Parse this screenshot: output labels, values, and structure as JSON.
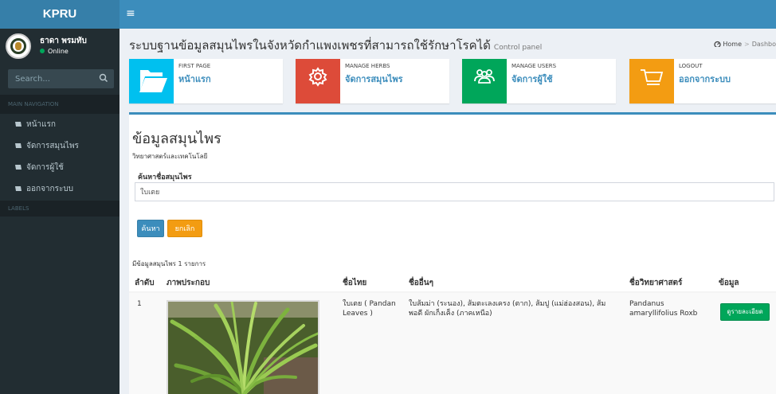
{
  "header": {
    "logo": "KPRU"
  },
  "sidebar": {
    "user_name": "ธาดา พรมทับ",
    "user_status": "Online",
    "search_placeholder": "Search...",
    "nav_header": "MAIN NAVIGATION",
    "items": [
      {
        "label": "หน้าแรก"
      },
      {
        "label": "จัดการสมุนไพร"
      },
      {
        "label": "จัดการผู้ใช้"
      },
      {
        "label": "ออกจากระบบ"
      }
    ],
    "labels_header": "LABELS"
  },
  "content_header": {
    "title": "ระบบฐานข้อมูลสมุนไพรในจังหวัดกำแพงเพชรที่สามารถใช้รักษาโรคได้",
    "subtitle": "Control panel",
    "breadcrumb_home": "Home",
    "breadcrumb_current": "Dashbo"
  },
  "info_boxes": [
    {
      "text1": "FIRST PAGE",
      "text2": "หน้าแรก",
      "color": "#00c0ef"
    },
    {
      "text1": "MANAGE HERBS",
      "text2": "จัดการสมุนไพร",
      "color": "#dd4b39"
    },
    {
      "text1": "MANAGE USERS",
      "text2": "จัดการผู้ใช้",
      "color": "#00a65a"
    },
    {
      "text1": "LOGOUT",
      "text2": "ออกจากระบบ",
      "color": "#f39c12"
    }
  ],
  "main": {
    "title": "ข้อมูลสมุนไพร",
    "subtitle": "วิทยาศาสตร์และเทคโนโลยี",
    "search_label": "ค้นหาชื่อสมุนไพร",
    "search_value": "ใบเตย",
    "search_button": "ค้นหา",
    "cancel_button": "ยกเลิก",
    "result_count": "มีข้อมูลสมุนไพร 1 รายการ",
    "columns": [
      "ลำดับ",
      "ภาพประกอบ",
      "ชื่อไทย",
      "ชื่ออื่นๆ",
      "ชื่อวิทยาศาสตร์",
      "ข้อมูล"
    ],
    "rows": [
      {
        "index": "1",
        "thai_name": "ใบเตย ( Pandan Leaves )",
        "other_names": "ใบส้มม่า (ระนอง), ส้มตะเลงเครง (ตาก), ส้มปู (แม่ฮ่องสอน), ส้มพอดี ผักเก็งเค็ง (ภาคเหนือ)",
        "scientific_name": "Pandanus amaryllifolius Roxb",
        "detail_button": "ดูรายละเอียด"
      }
    ]
  },
  "colors": {
    "primary": "#3c8dbc",
    "sidebar": "#222d32",
    "success": "#00a65a",
    "warning": "#f39c12"
  }
}
